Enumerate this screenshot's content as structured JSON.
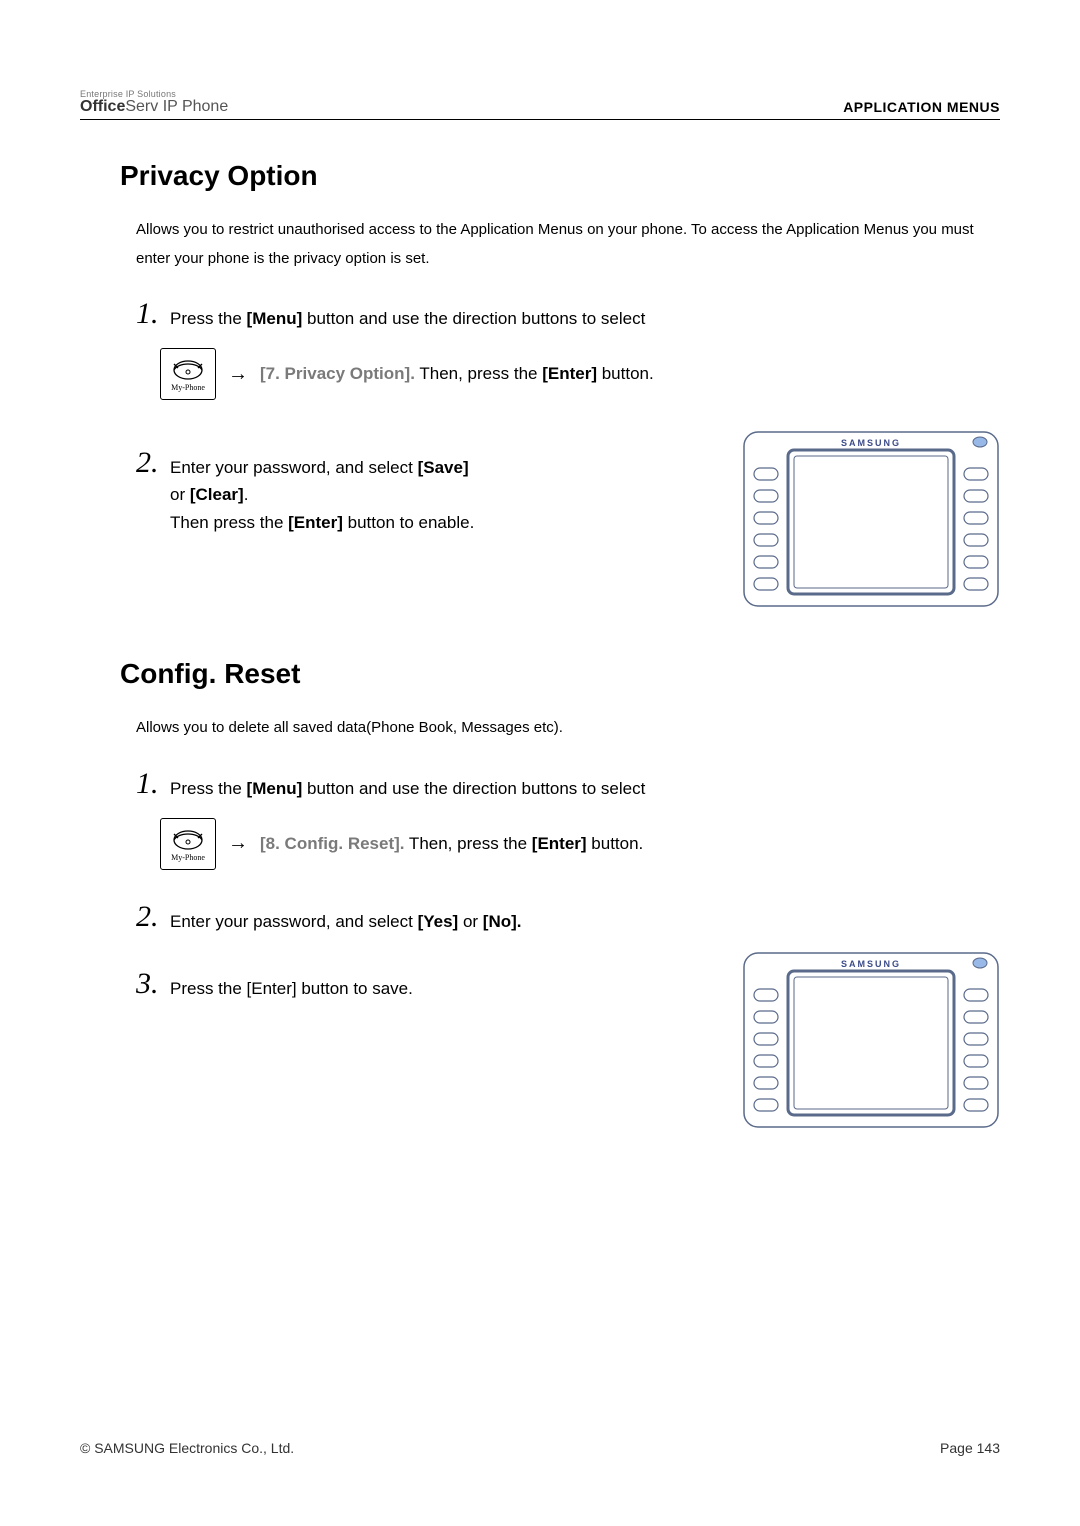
{
  "header": {
    "logo_top": "Enterprise IP Solutions",
    "logo_main_bold": "Office",
    "logo_main_rest": "Serv IP Phone",
    "right": "APPLICATION  MENUS"
  },
  "section1": {
    "title": "Privacy Option",
    "intro": "Allows you to restrict unauthorised access to the Application Menus on your phone. To access the Application Menus you must enter your phone is the privacy option is set.",
    "step1_num": "1.",
    "step1_a": " Press the ",
    "step1_b": "[Menu]",
    "step1_c": " button and use the direction buttons to select",
    "path_arrow": "→",
    "path_label": " [7. Privacy Option].",
    "path_then": "  Then, press the ",
    "path_enter": "[Enter]",
    "path_btn": " button.",
    "step2_num": "2.",
    "step2_a": " Enter your password, and select ",
    "step2_save": "[Save]",
    "step2_or": "or ",
    "step2_clear": "[Clear]",
    "step2_dot": ".",
    "step2_then": "Then press the ",
    "step2_enter": "[Enter]",
    "step2_end": " button to enable."
  },
  "section2": {
    "title": "Config. Reset",
    "intro": "Allows you to delete all saved data(Phone Book, Messages etc).",
    "step1_num": "1.",
    "step1_a": " Press the ",
    "step1_b": "[Menu]",
    "step1_c": " button and use the direction buttons to select",
    "path_arrow": "→",
    "path_label": " [8. Config. Reset].",
    "path_then": "  Then, press the ",
    "path_enter": "[Enter]",
    "path_btn": " button.",
    "step2_num": "2.",
    "step2_a": " Enter your password, and select ",
    "step2_yes": "[Yes]",
    "step2_or": " or ",
    "step2_no": "[No].",
    "step3_num": "3.",
    "step3_a": " Press the [Enter] button to save."
  },
  "phone_brand": "SAMSUNG",
  "myphone_label": "My-Phone",
  "footer": {
    "left": "© SAMSUNG Electronics Co., Ltd.",
    "right": "Page 143"
  }
}
